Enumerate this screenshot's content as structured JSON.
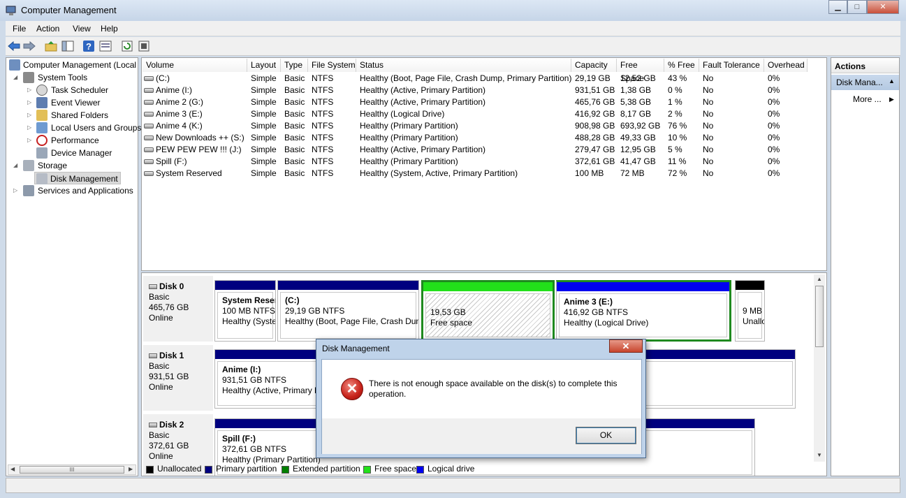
{
  "window": {
    "title": "Computer Management",
    "caption_min": "▁",
    "caption_max": "□",
    "caption_close": "✕"
  },
  "menu": [
    "File",
    "Action",
    "View",
    "Help"
  ],
  "toolbar_icons": [
    "back-arrow-icon",
    "forward-arrow-icon",
    "up-folder-icon",
    "show-hide-tree-icon",
    "help-icon",
    "properties-icon",
    "refresh-icon",
    "settings-icon"
  ],
  "tree": {
    "items": [
      {
        "label": "Computer Management (Local",
        "icon": "computer-icon",
        "expander": ""
      },
      {
        "label": "System Tools",
        "icon": "tools-icon",
        "expander": "◢"
      },
      {
        "label": "Task Scheduler",
        "icon": "clock-icon",
        "expander": "▷"
      },
      {
        "label": "Event Viewer",
        "icon": "event-viewer-icon",
        "expander": "▷"
      },
      {
        "label": "Shared Folders",
        "icon": "shared-folder-icon",
        "expander": "▷"
      },
      {
        "label": "Local Users and Groups",
        "icon": "users-icon",
        "expander": "▷"
      },
      {
        "label": "Performance",
        "icon": "performance-icon",
        "expander": "▷"
      },
      {
        "label": "Device Manager",
        "icon": "device-manager-icon",
        "expander": ""
      },
      {
        "label": "Storage",
        "icon": "storage-icon",
        "expander": "◢"
      },
      {
        "label": "Disk Management",
        "icon": "disk-icon",
        "expander": ""
      },
      {
        "label": "Services and Applications",
        "icon": "services-icon",
        "expander": "▷"
      }
    ],
    "scroll_thumb": "III"
  },
  "volumes": {
    "columns": [
      "Volume",
      "Layout",
      "Type",
      "File System",
      "Status",
      "Capacity",
      "Free Space",
      "% Free",
      "Fault Tolerance",
      "Overhead"
    ],
    "rows": [
      [
        "(C:)",
        "Simple",
        "Basic",
        "NTFS",
        "Healthy (Boot, Page File, Crash Dump, Primary Partition)",
        "29,19 GB",
        "12,52 GB",
        "43 %",
        "No",
        "0%"
      ],
      [
        "Anime (I:)",
        "Simple",
        "Basic",
        "NTFS",
        "Healthy (Active, Primary Partition)",
        "931,51 GB",
        "1,38 GB",
        "0 %",
        "No",
        "0%"
      ],
      [
        "Anime 2 (G:)",
        "Simple",
        "Basic",
        "NTFS",
        "Healthy (Active, Primary Partition)",
        "465,76 GB",
        "5,38 GB",
        "1 %",
        "No",
        "0%"
      ],
      [
        "Anime 3 (E:)",
        "Simple",
        "Basic",
        "NTFS",
        "Healthy (Logical Drive)",
        "416,92 GB",
        "8,17 GB",
        "2 %",
        "No",
        "0%"
      ],
      [
        "Anime 4 (K:)",
        "Simple",
        "Basic",
        "NTFS",
        "Healthy (Primary Partition)",
        "908,98 GB",
        "693,92 GB",
        "76 %",
        "No",
        "0%"
      ],
      [
        "New Downloads ++ (S:)",
        "Simple",
        "Basic",
        "NTFS",
        "Healthy (Primary Partition)",
        "488,28 GB",
        "49,33 GB",
        "10 %",
        "No",
        "0%"
      ],
      [
        "PEW PEW PEW !!! (J:)",
        "Simple",
        "Basic",
        "NTFS",
        "Healthy (Active, Primary Partition)",
        "279,47 GB",
        "12,95 GB",
        "5 %",
        "No",
        "0%"
      ],
      [
        "Spill (F:)",
        "Simple",
        "Basic",
        "NTFS",
        "Healthy (Primary Partition)",
        "372,61 GB",
        "41,47 GB",
        "11 %",
        "No",
        "0%"
      ],
      [
        "System Reserved",
        "Simple",
        "Basic",
        "NTFS",
        "Healthy (System, Active, Primary Partition)",
        "100 MB",
        "72 MB",
        "72 %",
        "No",
        "0%"
      ]
    ]
  },
  "disks": [
    {
      "name": "Disk 0",
      "type": "Basic",
      "size": "465,76 GB",
      "status": "Online",
      "partitions": [
        {
          "name": "System Reser",
          "size": "100 MB NTFS",
          "status": "Healthy (Syste",
          "color": "#00007f"
        },
        {
          "name": "(C:)",
          "size": "29,19 GB NTFS",
          "status": "Healthy (Boot, Page File, Crash Dum",
          "color": "#00007f"
        },
        {
          "name": "",
          "size": "19,53 GB",
          "status": "Free space",
          "color": "#22e01a"
        },
        {
          "name": "Anime 3  (E:)",
          "size": "416,92 GB NTFS",
          "status": "Healthy (Logical Drive)",
          "color": "#0000f0"
        },
        {
          "name": "",
          "size": "9 MB",
          "status": "Unallo",
          "color": "#000000"
        }
      ]
    },
    {
      "name": "Disk 1",
      "type": "Basic",
      "size": "931,51 GB",
      "status": "Online",
      "partitions": [
        {
          "name": "Anime  (I:)",
          "size": "931,51 GB NTFS",
          "status": "Healthy (Active, Primary Pa",
          "color": "#00007f"
        }
      ]
    },
    {
      "name": "Disk 2",
      "type": "Basic",
      "size": "372,61 GB",
      "status": "Online",
      "partitions": [
        {
          "name": "Spill  (F:)",
          "size": "372,61 GB NTFS",
          "status": "Healthy (Primary Partition)",
          "color": "#00007f"
        }
      ]
    }
  ],
  "legend": [
    {
      "label": "Unallocated",
      "color": "#000000"
    },
    {
      "label": "Primary partition",
      "color": "#00007f"
    },
    {
      "label": "Extended partition",
      "color": "#007f00"
    },
    {
      "label": "Free space",
      "color": "#22e01a"
    },
    {
      "label": "Logical drive",
      "color": "#0000f0"
    }
  ],
  "actions": {
    "header": "Actions",
    "section": "Disk Mana...",
    "more": "More ..."
  },
  "dialog": {
    "title": "Disk Management",
    "close": "✕",
    "message": "There is not enough space available on the disk(s) to complete this operation.",
    "ok": "OK",
    "icon": "error-icon"
  }
}
